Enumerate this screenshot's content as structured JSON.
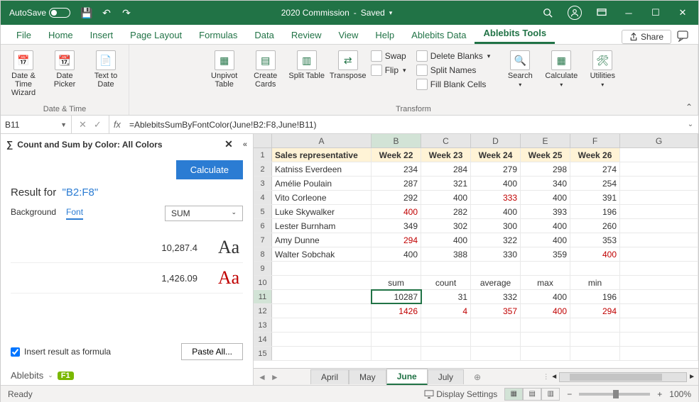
{
  "titlebar": {
    "autosave_label": "AutoSave",
    "autosave_state": "On",
    "doc_name": "2020 Commission",
    "save_state": "Saved"
  },
  "ribbon_tabs": [
    "File",
    "Home",
    "Insert",
    "Page Layout",
    "Formulas",
    "Data",
    "Review",
    "View",
    "Help",
    "Ablebits Data",
    "Ablebits Tools"
  ],
  "share_label": "Share",
  "ribbon": {
    "group_date_time": {
      "label": "Date & Time",
      "buttons": [
        "Date & Time Wizard",
        "Date Picker",
        "Text to Date"
      ]
    },
    "group_transform": {
      "label": "Transform",
      "buttons": [
        "Unpivot Table",
        "Create Cards",
        "Split Table",
        "Transpose"
      ],
      "small": [
        "Swap",
        "Flip"
      ]
    },
    "group_delete": {
      "small": [
        "Delete Blanks",
        "Split Names",
        "Fill Blank Cells"
      ]
    },
    "group_tools": [
      "Search",
      "Calculate",
      "Utilities"
    ]
  },
  "name_box": "B11",
  "formula": "=AblebitsSumByFontColor(June!B2:F8,June!B11)",
  "panel": {
    "title": "Count and Sum by Color: All Colors",
    "btn_calculate": "Calculate",
    "result_label": "Result for",
    "result_range": "\"B2:F8\"",
    "bg_label": "Background",
    "font_label": "Font",
    "agg_select": "SUM",
    "results": [
      {
        "value": "10,287.4",
        "sample": "Aa",
        "red": false
      },
      {
        "value": "1,426.09",
        "sample": "Aa",
        "red": true
      }
    ],
    "insert_label": "Insert result as formula",
    "paste_label": "Paste All...",
    "brand": "Ablebits",
    "help": "F1"
  },
  "columns": [
    "A",
    "B",
    "C",
    "D",
    "E",
    "F",
    "G"
  ],
  "headers_row": [
    "Sales representative",
    "Week 22",
    "Week 23",
    "Week 24",
    "Week 25",
    "Week 26"
  ],
  "rows": [
    {
      "n": "2",
      "a": "Katniss Everdeen",
      "v": [
        "234",
        "284",
        "279",
        "298",
        "274"
      ],
      "red": []
    },
    {
      "n": "3",
      "a": "Amélie Poulain",
      "v": [
        "287",
        "321",
        "400",
        "340",
        "254"
      ],
      "red": []
    },
    {
      "n": "4",
      "a": "Vito Corleone",
      "v": [
        "292",
        "400",
        "333",
        "400",
        "391"
      ],
      "red": [
        2
      ]
    },
    {
      "n": "5",
      "a": "Luke Skywalker",
      "v": [
        "400",
        "282",
        "400",
        "393",
        "196"
      ],
      "red": [
        0
      ]
    },
    {
      "n": "6",
      "a": "Lester Burnham",
      "v": [
        "349",
        "302",
        "300",
        "400",
        "260"
      ],
      "red": []
    },
    {
      "n": "7",
      "a": "Amy Dunne",
      "v": [
        "294",
        "400",
        "322",
        "400",
        "353"
      ],
      "red": [
        0
      ]
    },
    {
      "n": "8",
      "a": "Walter Sobchak",
      "v": [
        "400",
        "388",
        "330",
        "359",
        "400"
      ],
      "red": [
        4
      ]
    }
  ],
  "summary_labels": [
    "sum",
    "count",
    "average",
    "max",
    "min"
  ],
  "summary_r11": [
    "10287",
    "31",
    "332",
    "400",
    "196"
  ],
  "summary_r12": [
    "1426",
    "4",
    "357",
    "400",
    "294"
  ],
  "sheet_tabs": [
    "April",
    "May",
    "June",
    "July"
  ],
  "active_sheet": "June",
  "status": {
    "ready": "Ready",
    "display": "Display Settings",
    "zoom": "100%"
  }
}
